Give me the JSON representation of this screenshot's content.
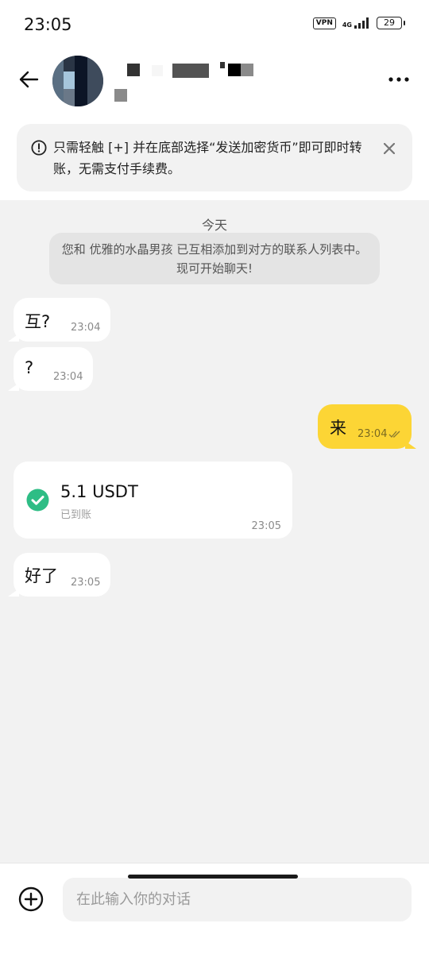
{
  "status_bar": {
    "time": "23:05",
    "vpn": "VPN",
    "network": "4G",
    "battery": "29"
  },
  "header": {
    "contact_name": "",
    "back_icon": "arrow-left-icon",
    "more_icon": "more-horizontal-icon"
  },
  "notice": {
    "text": "只需轻触 [+] 并在底部选择“发送加密货币”即可即时转账，无需支付手续费。",
    "icon": "info-icon",
    "close_icon": "close-icon"
  },
  "chat": {
    "date_divider": "今天",
    "system_message": "您和 优雅的水晶男孩 已互相添加到对方的联系人列表中。现可开始聊天!",
    "messages": [
      {
        "direction": "in",
        "text": "互?",
        "time": "23:04"
      },
      {
        "direction": "in",
        "text": "?",
        "time": "23:04"
      },
      {
        "direction": "out",
        "text": "来",
        "time": "23:04",
        "status": "read"
      },
      {
        "direction": "in",
        "text": "好了",
        "time": "23:05"
      }
    ],
    "transfer": {
      "amount": "5.1 USDT",
      "status": "已到账",
      "time": "23:05",
      "status_color": "#2ebd85"
    }
  },
  "composer": {
    "placeholder": "在此输入你的对话",
    "value": "",
    "attach_icon": "plus-circle-icon"
  },
  "colors": {
    "outgoing_bubble": "#fcd535",
    "incoming_bubble": "#ffffff",
    "chat_background": "#f2f2f2",
    "success": "#2ebd85"
  }
}
